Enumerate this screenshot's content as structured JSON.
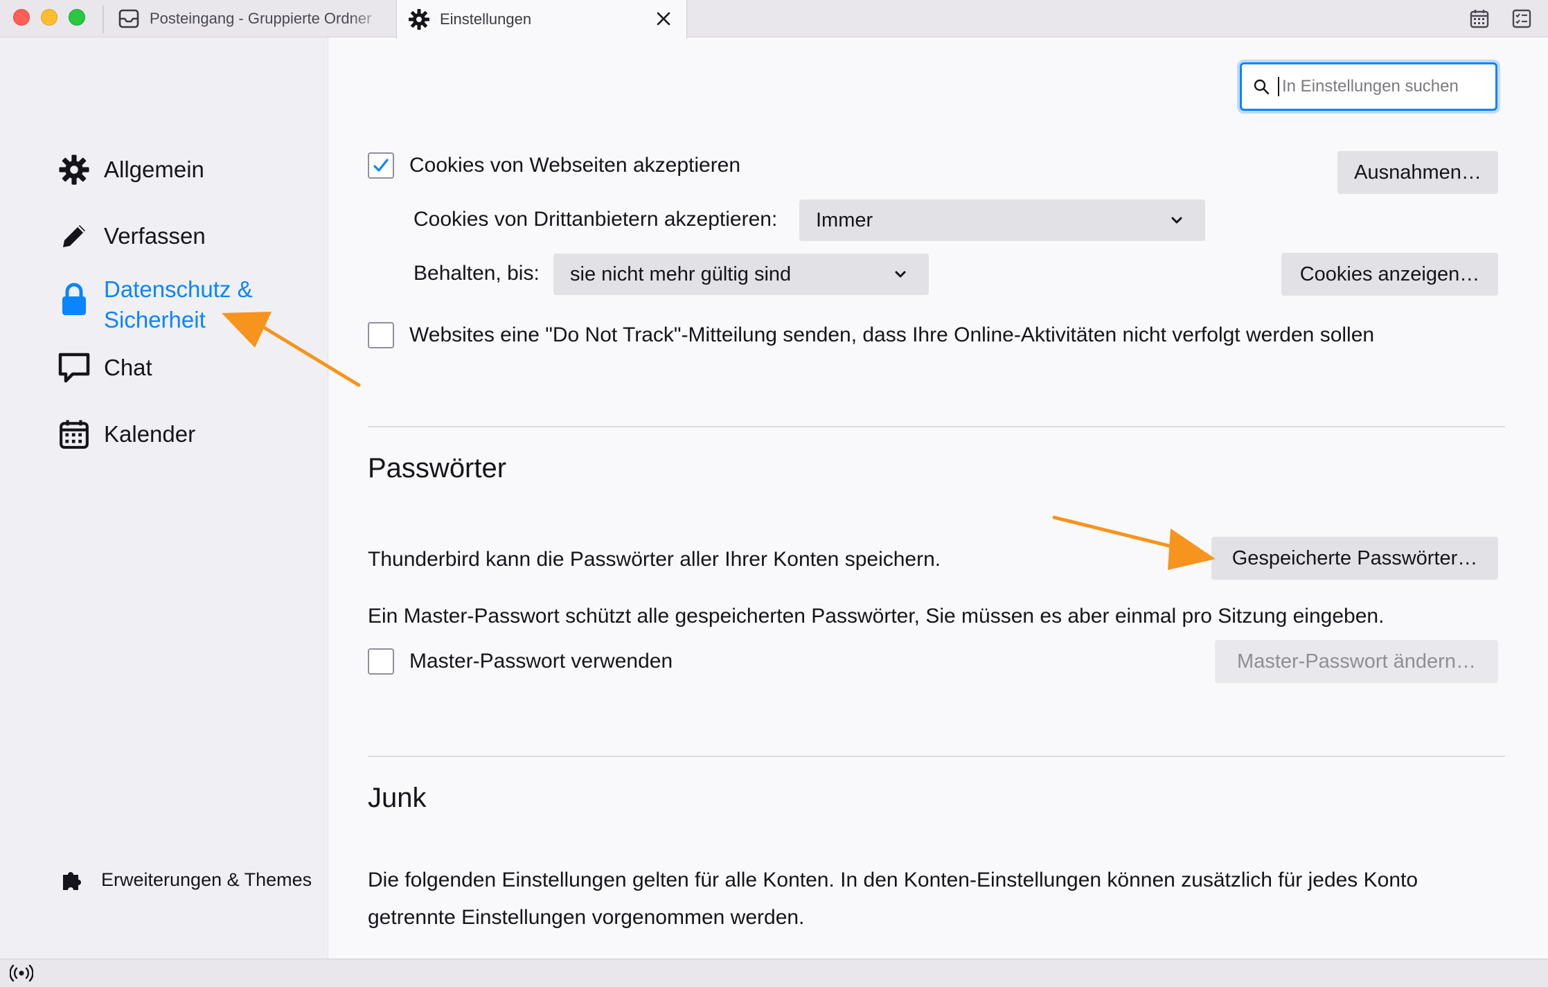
{
  "tabs": [
    {
      "label": "Posteingang - Gruppierte Ordner",
      "icon": "inbox-icon",
      "active": false
    },
    {
      "label": "Einstellungen",
      "icon": "gear-icon",
      "active": true
    }
  ],
  "toolbar": {
    "icons": [
      "calendar-icon",
      "tasks-icon"
    ]
  },
  "sidebar": {
    "items": [
      {
        "label": "Allgemein",
        "icon": "gear-icon"
      },
      {
        "label": "Verfassen",
        "icon": "pencil-icon"
      },
      {
        "label": "Datenschutz & Sicherheit",
        "icon": "lock-icon",
        "selected": true
      },
      {
        "label": "Chat",
        "icon": "chat-icon"
      },
      {
        "label": "Kalender",
        "icon": "calendar-icon"
      }
    ],
    "footer": {
      "label": "Erweiterungen & Themes",
      "icon": "puzzle-icon"
    }
  },
  "search": {
    "placeholder": "In Einstellungen suchen",
    "value": ""
  },
  "cookies": {
    "accept_label": "Cookies von Webseiten akzeptieren",
    "accept_checked": true,
    "exceptions_button": "Ausnahmen…",
    "third_party_label": "Cookies von Drittanbietern akzeptieren:",
    "third_party_value": "Immer",
    "keep_label": "Behalten, bis:",
    "keep_value": "sie nicht mehr gültig sind",
    "show_button": "Cookies anzeigen…",
    "dnt_label": "Websites eine \"Do Not Track\"-Mitteilung senden, dass Ihre Online-Aktivitäten nicht verfolgt werden sollen",
    "dnt_checked": false
  },
  "passwords": {
    "heading": "Passwörter",
    "description": "Thunderbird kann die Passwörter aller Ihrer Konten speichern.",
    "saved_button": "Gespeicherte Passwörter…",
    "master_description": "Ein Master-Passwort schützt alle gespeicherten Passwörter, Sie müssen es aber einmal pro Sitzung eingeben.",
    "master_checkbox_label": "Master-Passwort verwenden",
    "master_checked": false,
    "change_master_button": "Master-Passwort ändern…"
  },
  "junk": {
    "heading": "Junk",
    "description": "Die folgenden Einstellungen gelten für alle Konten. In den Konten-Einstellungen können zusätzlich für jedes Konto getrennte Einstellungen vorgenommen werden."
  },
  "colors": {
    "accent": "#0a84ff",
    "annotation_arrow": "#f7941d"
  },
  "statusbar": {
    "icon": "online-status-icon"
  }
}
